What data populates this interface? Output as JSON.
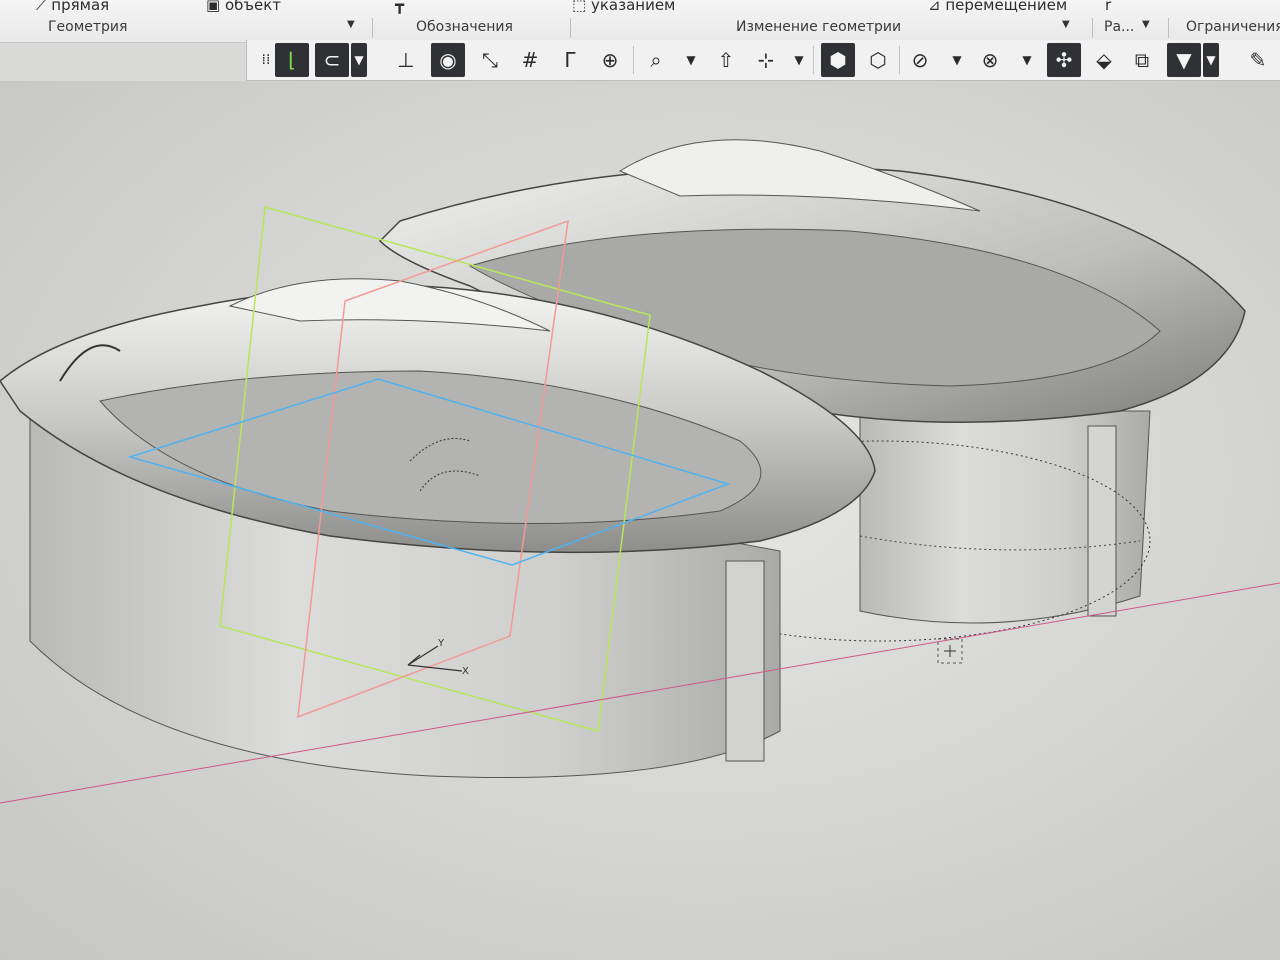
{
  "ribbon": {
    "tools": {
      "line": "прямая",
      "object": "объект",
      "pointer": "указанием",
      "move": "перемещением",
      "r": "r"
    },
    "groups": {
      "geometry": "Геометрия",
      "designations": "Обозначения",
      "change_geometry": "Изменение геометрии",
      "ra": "Ра...",
      "constraints": "Ограничения"
    }
  },
  "toolbar": {
    "icons": [
      "grip-icon",
      "sketch-icon",
      "magnet-icon",
      "dropdown-icon",
      "perpendicular-icon",
      "eye-icon",
      "view-normal-icon",
      "grid-icon",
      "corner-icon",
      "zoom-icon",
      "zoom-window-icon",
      "dropdown-icon",
      "orient-icon",
      "axes-icon",
      "dropdown-icon",
      "shaded-icon",
      "wireframe-icon",
      "hidden-lines-icon",
      "dropdown-icon",
      "visibility-icon",
      "dropdown-icon",
      "snap-icon",
      "render-icon",
      "layers-icon",
      "filter-icon",
      "dropdown-icon",
      "pen-icon"
    ]
  },
  "viewport": {
    "axis_labels": {
      "y": "Y",
      "x": "X"
    },
    "colors": {
      "background": "#d9d9d7",
      "body": "#c9c9c7",
      "plane_green": "#b7e65a",
      "plane_red": "#f29a93",
      "plane_blue": "#4fb3f0",
      "axis_line": "#d0568a"
    }
  }
}
